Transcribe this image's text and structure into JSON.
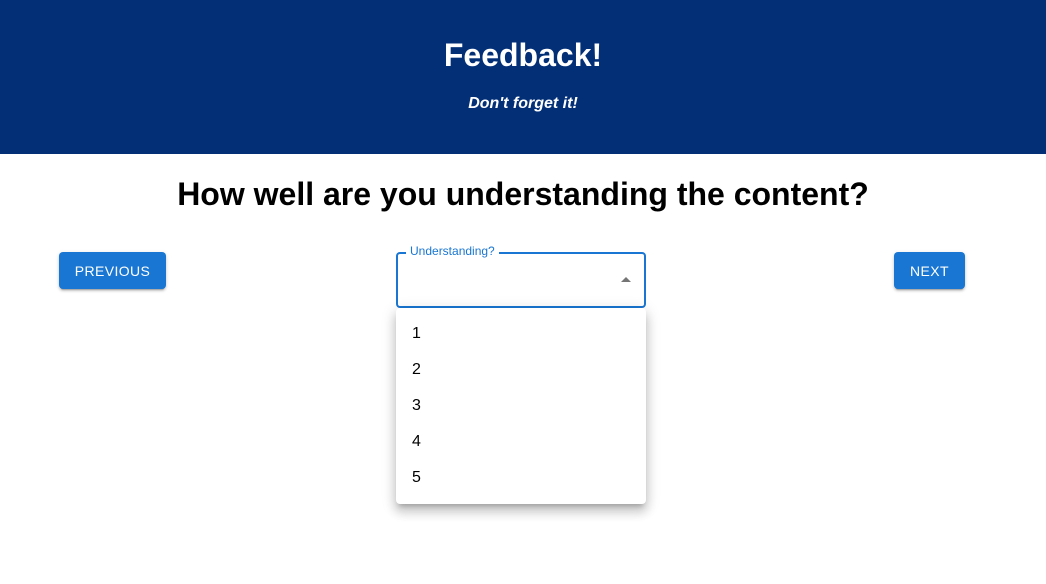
{
  "header": {
    "title": "Feedback!",
    "subtitle": "Don't forget it!"
  },
  "question": "How well are you understanding the content?",
  "nav": {
    "previous_label": "PREVIOUS",
    "next_label": "NEXT"
  },
  "select": {
    "label": "Understanding?",
    "value": "",
    "options": [
      "1",
      "2",
      "3",
      "4",
      "5"
    ]
  },
  "colors": {
    "header_bg": "#032f77",
    "accent": "#1976d2"
  }
}
